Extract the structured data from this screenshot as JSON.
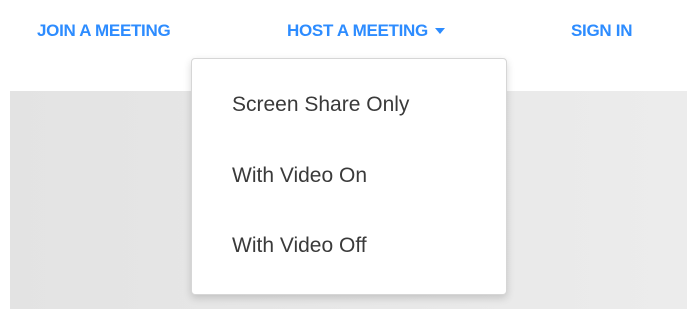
{
  "nav": {
    "join_label": "JOIN A MEETING",
    "host_label": "HOST A MEETING",
    "signin_label": "SIGN IN",
    "host_dropdown_icon": "caret-down-icon"
  },
  "host_menu": {
    "items": [
      {
        "label": "Screen Share Only"
      },
      {
        "label": "With Video On"
      },
      {
        "label": "With Video Off"
      }
    ]
  },
  "colors": {
    "link": "#2d8cff",
    "menu_text": "#3a3a3a",
    "background_panel": "#e6e6e6"
  }
}
